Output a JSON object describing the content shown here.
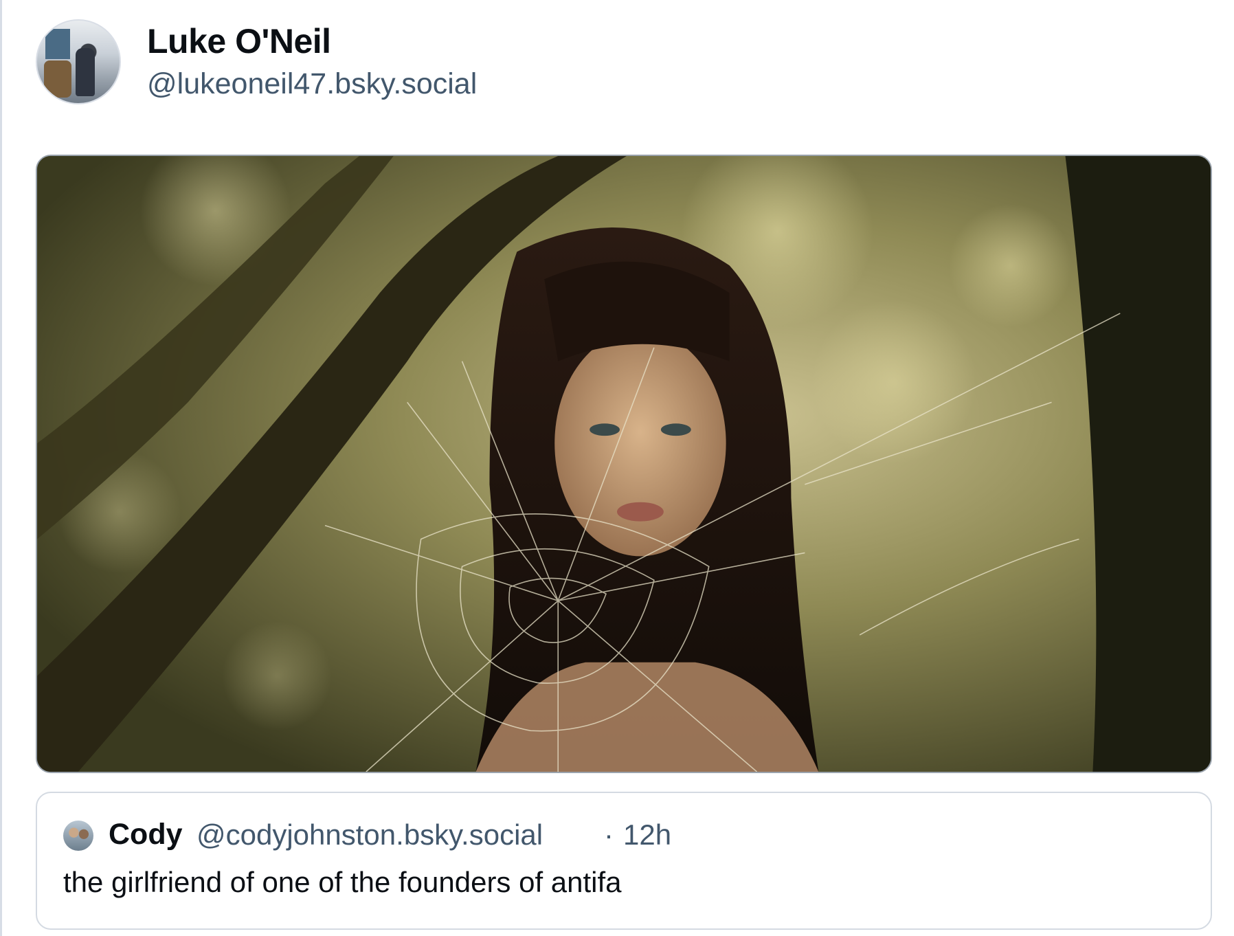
{
  "post": {
    "author": {
      "name": "Luke O'Neil",
      "handle": "@lukeoneil47.bsky.social",
      "avatar_icon": "avatar-image"
    },
    "image": {
      "icon": "photo-image",
      "alt": ""
    },
    "quote": {
      "author_name": "Cody",
      "author_handle": "@codyjohnston.bsky.social",
      "separator": "·",
      "timestamp": "12h",
      "text": "the girlfriend of one of the founders of antifa"
    }
  },
  "colors": {
    "text_primary": "#0b0f14",
    "text_secondary": "#42576c",
    "border": "#d4dae2"
  }
}
